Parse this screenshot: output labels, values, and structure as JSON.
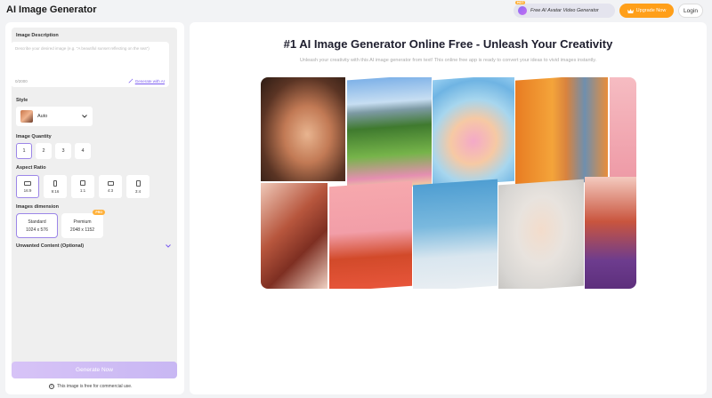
{
  "header": {
    "title": "AI Image Generator",
    "promo_label": "Free AI Avatar Video Generator",
    "hot_badge": "HOT",
    "upgrade_label": "Upgrade Now",
    "login_label": "Login"
  },
  "form": {
    "description_label": "Image Description",
    "description_placeholder": "Describe your desired image (e.g. \"A beautiful sunset reflecting on the sea\")",
    "char_count": "0/2000",
    "generate_ai_label": "Generate with AI",
    "style_label": "Style",
    "style_value": "Auto",
    "quantity_label": "Image Quantity",
    "quantities": [
      "1",
      "2",
      "3",
      "4"
    ],
    "selected_quantity": "1",
    "aspect_label": "Aspect Ratio",
    "aspect_ratios": [
      "16:9",
      "9:16",
      "1:1",
      "4:3",
      "3:4"
    ],
    "selected_aspect": "16:9",
    "dimension_label": "Images dimension",
    "dimensions": [
      {
        "name": "Standard",
        "size": "1024 x 576"
      },
      {
        "name": "Premium",
        "size": "2048 x 1152",
        "badge": "PRO"
      }
    ],
    "unwanted_label": "Unwanted Content (Optional)",
    "generate_button": "Generate Now",
    "commercial_note": "This image is free for commercial use."
  },
  "hero": {
    "title": "#1 AI Image Generator Online Free - Unleash Your Creativity",
    "subtitle": "Unleash your creativity with this AI image generator from text! This online free app is ready to convert your ideas to vivid images instantly."
  },
  "colors": {
    "accent": "#7b5cf0",
    "upgrade": "#ff9f19",
    "selected_border": "#9c86e8",
    "generate_button": "#d7c3f7"
  },
  "icons": [
    "promo-avatar-icon",
    "crown-icon",
    "wand-icon",
    "chevron-down-icon",
    "copyright-icon"
  ]
}
